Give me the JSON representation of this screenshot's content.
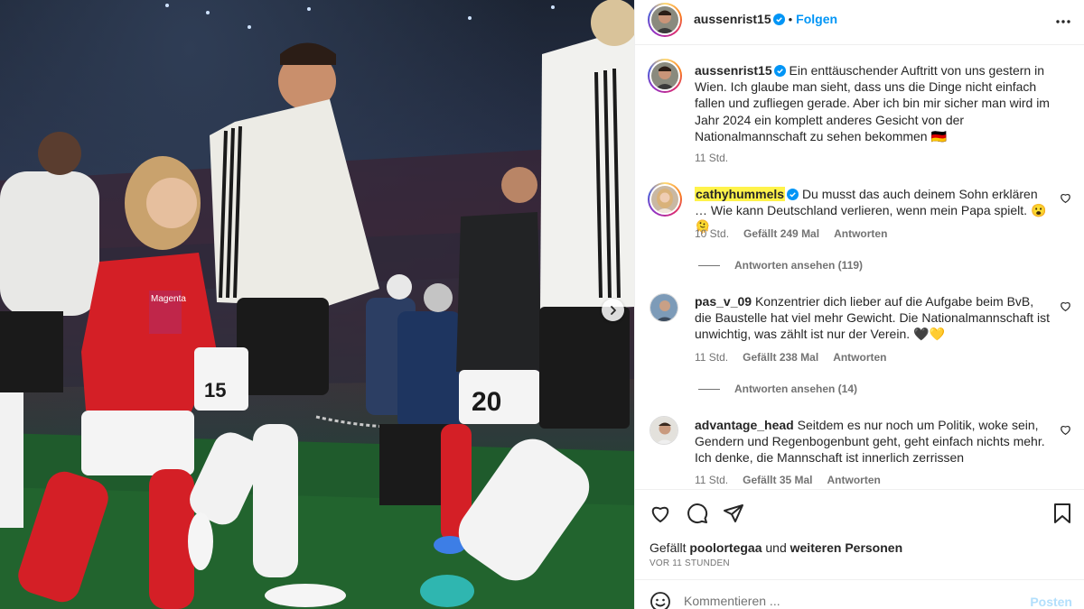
{
  "post": {
    "author": "aussenrist15",
    "follow_label": "Folgen",
    "separator": "•",
    "caption": "Ein enttäuschender Auftritt von uns gestern in Wien. Ich glaube man sieht, dass uns die Dinge nicht einfach fallen und zufliegen gerade. Aber ich bin mir sicher man wird im Jahr 2024 ein komplett anderes Gesicht von der Nationalmannschaft zu sehen bekommen 🇩🇪",
    "caption_time": "11 Std."
  },
  "comments": [
    {
      "user": "cathyhummels",
      "verified": true,
      "highlighted": true,
      "text": "Du musst das auch deinem Sohn erklären … Wie kann Deutschland verlieren, wenn mein Papa spielt. 😮🫠",
      "time": "10 Std.",
      "likes": "Gefällt 249 Mal",
      "reply_label": "Antworten",
      "view_replies": "Antworten ansehen (119)"
    },
    {
      "user": "pas_v_09",
      "verified": false,
      "text": "Konzentrier dich lieber auf die Aufgabe beim BvB, die Baustelle hat viel mehr Gewicht. Die Nationalmannschaft ist unwichtig, was zählt ist nur der Verein. 🖤💛",
      "time": "11 Std.",
      "likes": "Gefällt 238 Mal",
      "reply_label": "Antworten",
      "view_replies": "Antworten ansehen (14)"
    },
    {
      "user": "advantage_head",
      "verified": false,
      "text": "Seitdem es nur noch um Politik, woke sein, Gendern und Regenbogenbunt geht, geht einfach nichts mehr. Ich denke, die Mannschaft ist innerlich zerrissen",
      "time": "11 Std.",
      "likes": "Gefällt 35 Mal",
      "reply_label": "Antworten"
    }
  ],
  "liked_by": {
    "prefix": "Gefällt",
    "user": "poolortegaa",
    "middle": "und",
    "suffix": "weiteren Personen"
  },
  "posted_ago": "VOR 11 STUNDEN",
  "comment_box": {
    "placeholder": "Kommentieren ...",
    "post_label": "Posten"
  },
  "photo": {
    "jersey_numbers": [
      "15",
      "20"
    ],
    "banner_text": "Magenta"
  },
  "colors": {
    "follow_blue": "#0095f6",
    "verified_blue": "#0095f6",
    "highlight_yellow": "#fff34a",
    "muted_text": "#737373"
  },
  "icons": [
    "verified-badge-icon",
    "more-options-icon",
    "heart-icon",
    "comment-icon",
    "share-icon",
    "bookmark-icon",
    "emoji-icon",
    "next-arrow-icon"
  ]
}
